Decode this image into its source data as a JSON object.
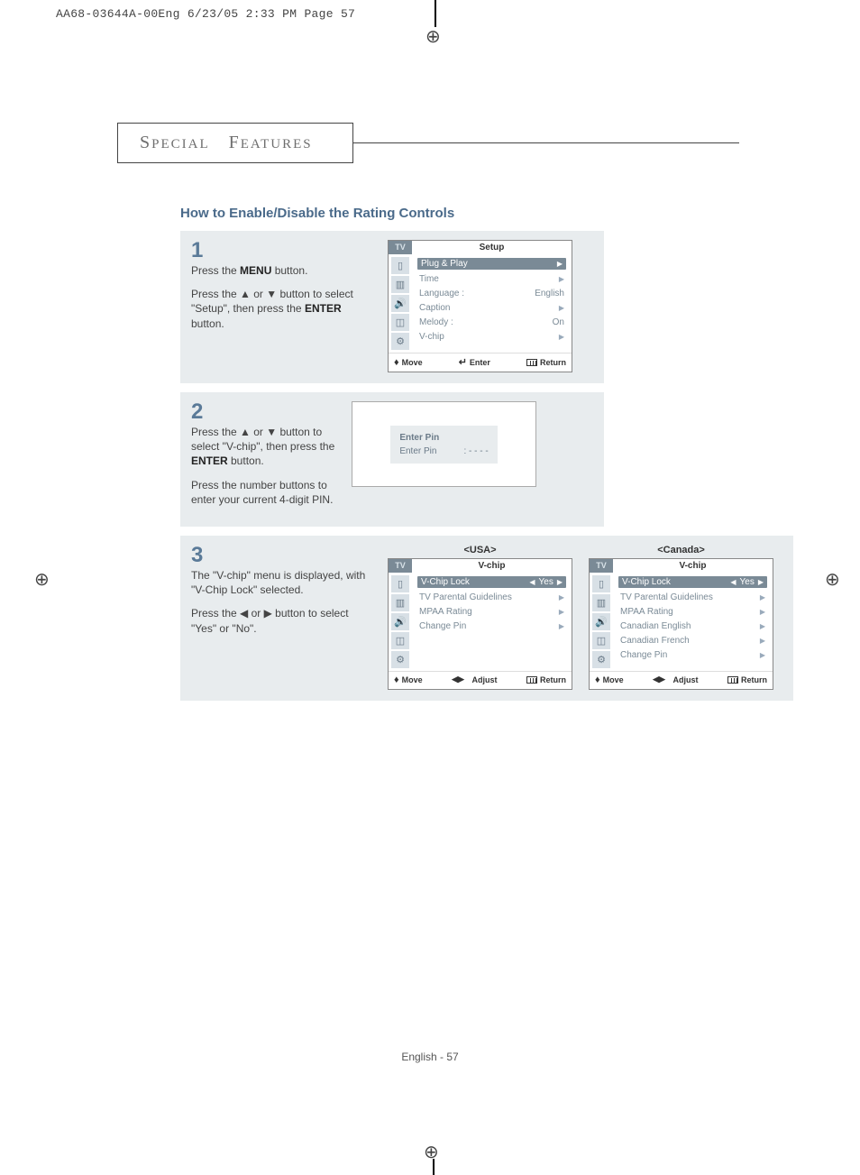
{
  "print_header": "AA68-03644A-00Eng  6/23/05  2:33 PM  Page 57",
  "section_header": {
    "word1_cap": "S",
    "word1_rest": "PECIAL",
    "word2_cap": "F",
    "word2_rest": "EATURES"
  },
  "page_title": "How to Enable/Disable the Rating Controls",
  "steps": {
    "s1": {
      "num": "1",
      "p1a": "Press the ",
      "p1b": "MENU",
      "p1c": " button.",
      "p2a": "Press the ▲ or ▼ button to select \"Setup\", then press the ",
      "p2b": "ENTER",
      "p2c": " button."
    },
    "s2": {
      "num": "2",
      "p1a": "Press the ▲ or ▼ button to  select  \"V-chip\", then press the ",
      "p1b": "ENTER",
      "p1c": " button.",
      "p2": "Press the number buttons to enter your current 4-digit PIN."
    },
    "s3": {
      "num": "3",
      "p1": "The \"V-chip\" menu is displayed, with \"V-Chip Lock\" selected.",
      "p2": "Press the ◀ or ▶ button to select  \"Yes\" or \"No\"."
    }
  },
  "osd_setup": {
    "tv": "TV",
    "title": "Setup",
    "rows": {
      "plug_play": "Plug & Play",
      "time": "Time",
      "language_label": "Language :",
      "language_value": "English",
      "caption": "Caption",
      "melody_label": "Melody    :",
      "melody_value": "On",
      "vchip": "V-chip"
    },
    "footer_move": "Move",
    "footer_enter": "Enter",
    "footer_return": "Return"
  },
  "osd_pin": {
    "title": "Enter Pin",
    "row_label": "Enter Pin",
    "row_value": ": - - - -"
  },
  "osd_usa": {
    "region": "<USA>",
    "tv": "TV",
    "title": "V-chip",
    "rows": {
      "lock_label": "V-Chip Lock",
      "lock_value": "Yes",
      "parental": "TV Parental Guidelines",
      "mpaa": "MPAA Rating",
      "change_pin": "Change Pin"
    },
    "footer_move": "Move",
    "footer_adjust": "Adjust",
    "footer_return": "Return"
  },
  "osd_canada": {
    "region": "<Canada>",
    "tv": "TV",
    "title": "V-chip",
    "rows": {
      "lock_label": "V-Chip Lock",
      "lock_value": "Yes",
      "parental": "TV Parental Guidelines",
      "mpaa": "MPAA Rating",
      "can_en": "Canadian English",
      "can_fr": "Canadian French",
      "change_pin": "Change Pin"
    },
    "footer_move": "Move",
    "footer_adjust": "Adjust",
    "footer_return": "Return"
  },
  "page_footer": "English - 57"
}
